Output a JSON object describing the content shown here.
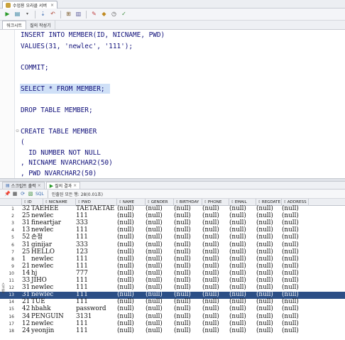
{
  "window": {
    "tab_title": "수업용 오라클 서버"
  },
  "subtabs": [
    "워크시트",
    "질의 작성기"
  ],
  "editor": {
    "lines": [
      "INSERT INTO MEMBER(ID, NICNAME, PWD)",
      "VALUES(31, 'newlec', '111');",
      "",
      "COMMIT;",
      "",
      "SELECT * FROM MEMBER;",
      "",
      "DROP TABLE MEMBER;",
      "",
      "CREATE TABLE MEMBER",
      "(",
      "  ID NUMBER NOT NULL",
      ", NICNAME NVARCHAR2(50)",
      ", PWD NVARCHAR2(50)"
    ]
  },
  "panel": {
    "tabs": [
      {
        "label": "스크립트 출력"
      },
      {
        "label": "질의 결과"
      }
    ],
    "toolbar": {
      "sql_label": "SQL",
      "status": "인출된 모든 행: 28(0.01초)"
    }
  },
  "grid": {
    "columns": [
      "ID",
      "NICNAME",
      "PWD",
      "NAME",
      "GENDER",
      "BIRTHDAY",
      "PHONE",
      "EMAIL",
      "REGDATE",
      "ADDRESS"
    ],
    "selected_row": 10,
    "rows": [
      [
        "1",
        "32",
        "TAEHEE",
        "TAETAETAE",
        "(null)",
        "(null)",
        "(null)",
        "(null)",
        "(null)",
        "(null)",
        "(null)"
      ],
      [
        "2",
        "25",
        "newlec",
        "111",
        "(null)",
        "(null)",
        "(null)",
        "(null)",
        "(null)",
        "(null)",
        "(null)"
      ],
      [
        "3",
        "31",
        "fineartjar",
        "333",
        "(null)",
        "(null)",
        "(null)",
        "(null)",
        "(null)",
        "(null)",
        "(null)"
      ],
      [
        "4",
        "13",
        "newlec",
        "111",
        "(null)",
        "(null)",
        "(null)",
        "(null)",
        "(null)",
        "(null)",
        "(null)"
      ],
      [
        "5",
        "52",
        "손정",
        "111",
        "(null)",
        "(null)",
        "(null)",
        "(null)",
        "(null)",
        "(null)",
        "(null)"
      ],
      [
        "6",
        "31",
        "ginijar",
        "333",
        "(null)",
        "(null)",
        "(null)",
        "(null)",
        "(null)",
        "(null)",
        "(null)"
      ],
      [
        "7",
        "25",
        "HELLO",
        "123",
        "(null)",
        "(null)",
        "(null)",
        "(null)",
        "(null)",
        "(null)",
        "(null)"
      ],
      [
        "8",
        "1",
        "newlec",
        "111",
        "(null)",
        "(null)",
        "(null)",
        "(null)",
        "(null)",
        "(null)",
        "(null)"
      ],
      [
        "9",
        "21",
        "newlec",
        "111",
        "(null)",
        "(null)",
        "(null)",
        "(null)",
        "(null)",
        "(null)",
        "(null)"
      ],
      [
        "10",
        "14",
        "hj",
        "777",
        "(null)",
        "(null)",
        "(null)",
        "(null)",
        "(null)",
        "(null)",
        "(null)"
      ],
      [
        "11",
        "33",
        "JIHO",
        "111",
        "(null)",
        "(null)",
        "(null)",
        "(null)",
        "(null)",
        "(null)",
        "(null)"
      ],
      [
        "12",
        "31",
        "newlec",
        "111",
        "(null)",
        "(null)",
        "(null)",
        "(null)",
        "(null)",
        "(null)",
        "(null)"
      ],
      [
        "13",
        "31",
        "newlec",
        "111",
        "(null)",
        "(null)",
        "(null)",
        "(null)",
        "(null)",
        "(null)",
        "(null)"
      ],
      [
        "14",
        "21",
        "TUE",
        "111",
        "(null)",
        "(null)",
        "(null)",
        "(null)",
        "(null)",
        "(null)",
        "(null)"
      ],
      [
        "15",
        "42",
        "hbahk",
        "password",
        "(null)",
        "(null)",
        "(null)",
        "(null)",
        "(null)",
        "(null)",
        "(null)"
      ],
      [
        "16",
        "34",
        "PENGUIN",
        "3131",
        "(null)",
        "(null)",
        "(null)",
        "(null)",
        "(null)",
        "(null)",
        "(null)"
      ],
      [
        "17",
        "12",
        "newlec",
        "111",
        "(null)",
        "(null)",
        "(null)",
        "(null)",
        "(null)",
        "(null)",
        "(null)"
      ],
      [
        "18",
        "24",
        "yeonjin",
        "111",
        "(null)",
        "(null)",
        "(null)",
        "(null)",
        "(null)",
        "(null)",
        "(null)"
      ]
    ]
  },
  "side_label": "스크립"
}
